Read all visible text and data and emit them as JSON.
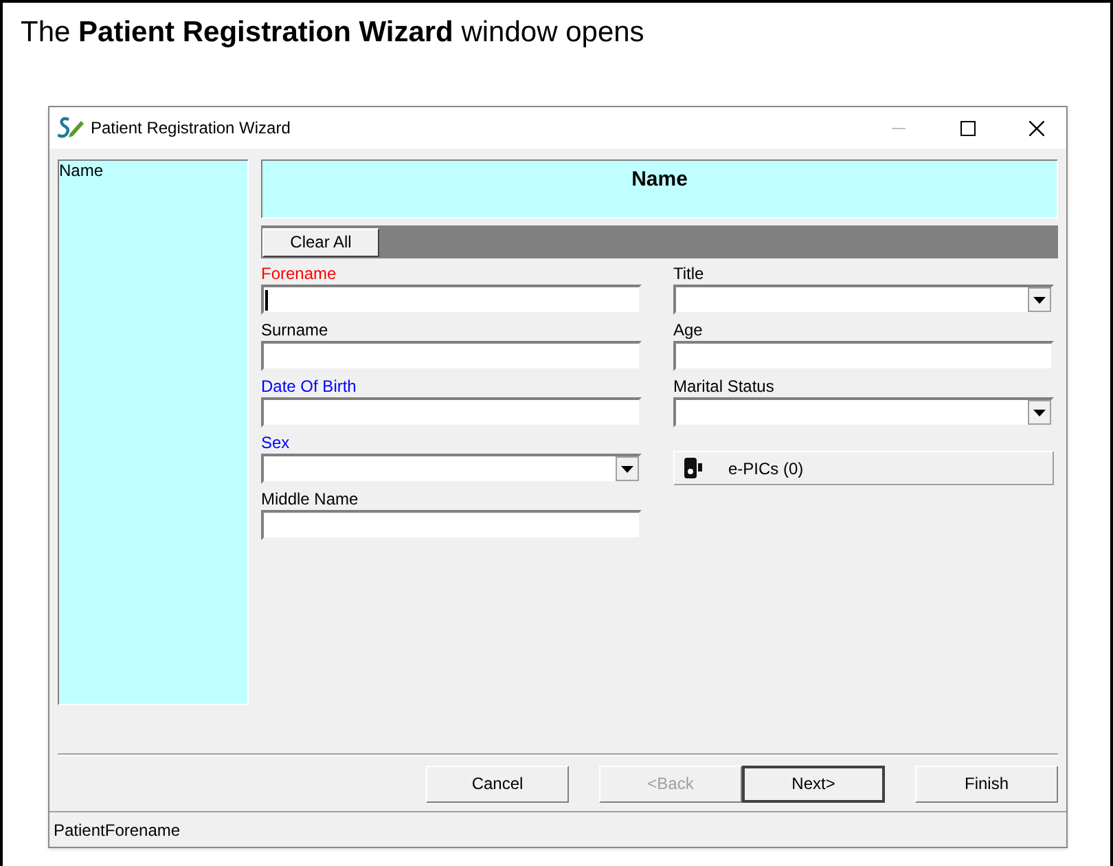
{
  "caption": "The **Patient Registration Wizard** window opens",
  "window": {
    "title": "Patient Registration Wizard"
  },
  "steps": [
    {
      "label": "Name",
      "selected": false
    }
  ],
  "header": "Name",
  "clear_button": "Clear All",
  "fields_left": [
    {
      "label": "Forename",
      "kind": "text",
      "color": "#ff0000",
      "focused": true
    },
    {
      "label": "Surname",
      "kind": "text",
      "color": "#000000",
      "focused": false
    },
    {
      "label": "Date Of Birth",
      "kind": "text",
      "color": "#0000ff",
      "focused": false
    },
    {
      "label": "Sex",
      "kind": "select",
      "color": "#0000ff",
      "focused": false
    },
    {
      "label": "Middle Name",
      "kind": "text",
      "color": "#000000",
      "focused": false
    }
  ],
  "fields_right": [
    {
      "label": "Title",
      "kind": "select",
      "color": "#000000",
      "focused": false
    },
    {
      "label": "Age",
      "kind": "text",
      "color": "#000000",
      "focused": false
    },
    {
      "label": "Marital Status",
      "kind": "select",
      "color": "#000000",
      "focused": false
    }
  ],
  "epics_button": "e-PICs (0)",
  "buttons": [
    {
      "label": "Cancel",
      "disabled": false,
      "default": false
    },
    {
      "label": "<Back",
      "disabled": true,
      "default": false
    },
    {
      "label": "Next>",
      "disabled": false,
      "default": true
    },
    {
      "label": "Finish",
      "disabled": false,
      "default": false
    }
  ],
  "status_bar": "PatientForename"
}
